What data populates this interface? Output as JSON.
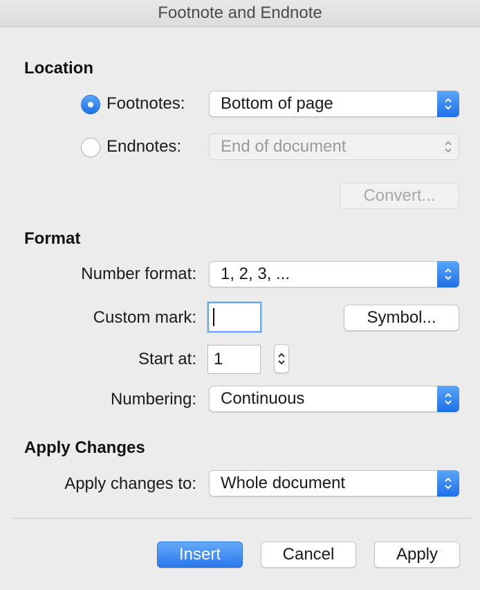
{
  "window": {
    "title": "Footnote and Endnote"
  },
  "location": {
    "heading": "Location",
    "footnotes": {
      "label": "Footnotes:",
      "selected": true,
      "value": "Bottom of page"
    },
    "endnotes": {
      "label": "Endnotes:",
      "selected": false,
      "value": "End of document"
    },
    "convert_label": "Convert..."
  },
  "format": {
    "heading": "Format",
    "number_format": {
      "label": "Number format:",
      "value": "1, 2, 3, ..."
    },
    "custom_mark": {
      "label": "Custom mark:",
      "value": ""
    },
    "symbol_label": "Symbol...",
    "start_at": {
      "label": "Start at:",
      "value": "1"
    },
    "numbering": {
      "label": "Numbering:",
      "value": "Continuous"
    }
  },
  "apply_changes": {
    "heading": "Apply Changes",
    "apply_to": {
      "label": "Apply changes to:",
      "value": "Whole document"
    }
  },
  "buttons": {
    "insert": "Insert",
    "cancel": "Cancel",
    "apply": "Apply"
  },
  "colors": {
    "accent": "#2a78ec",
    "background": "#ececec"
  }
}
